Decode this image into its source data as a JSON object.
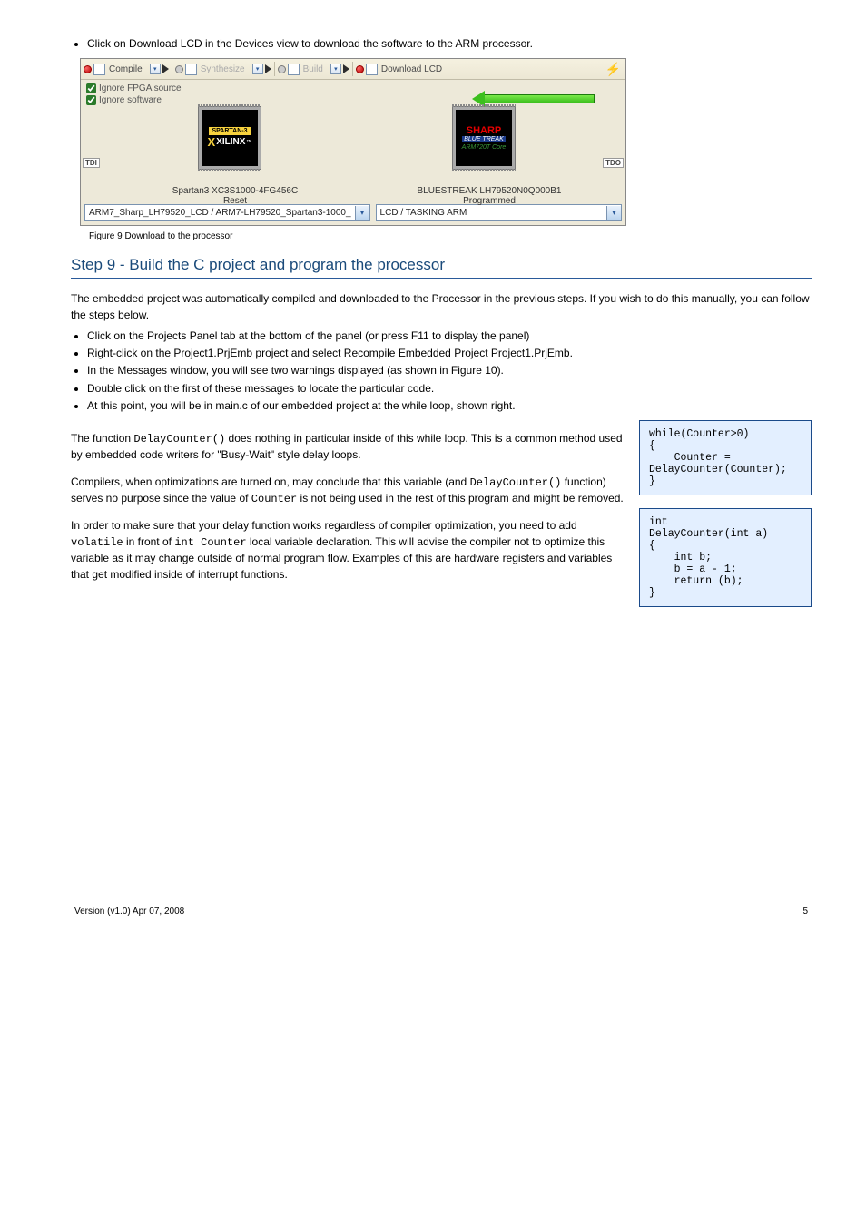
{
  "bullet_top": "Click on Download LCD in the Devices view to download the software to the ARM processor.",
  "screenshot": {
    "toolbar": {
      "compile": "Compile",
      "synthesize": "Synthesize",
      "build": "Build",
      "download": "Download LCD"
    },
    "checks": {
      "fpga": "Ignore FPGA source",
      "sw": "Ignore software"
    },
    "tdi": "TDI",
    "tdo": "TDO",
    "chipA": {
      "spartan": "SPARTAN-3",
      "xilinx": "XILINX",
      "label1": "Spartan3 XC3S1000-4FG456C",
      "label2": "Reset"
    },
    "chipB": {
      "sharp": "SHARP",
      "blue": "BLUE   TREAK",
      "core": "ARM720T Core",
      "label1": "BLUESTREAK LH79520N0Q000B1",
      "label2": "Programmed"
    },
    "combo1": "ARM7_Sharp_LH79520_LCD / ARM7-LH79520_Spartan3-1000_",
    "combo2": "LCD / TASKING ARM"
  },
  "fig_caption": "Figure 9 Download to the processor",
  "section": {
    "title": "Step 9 - Build the C project and program the processor",
    "intro": "The embedded project was automatically compiled and downloaded to the Processor in the previous steps. If you wish to do this manually, you can follow the steps below.",
    "bullets": [
      "Click on the Projects Panel tab at the bottom of the panel (or press F11 to display the panel)",
      "Right-click on the Project1.PrjEmb project and select Recompile Embedded Project Project1.PrjEmb.",
      "In the Messages window, you will see two warnings displayed (as shown in Figure 10).",
      "Double click on the first of these messages to locate the particular code.",
      "At this point, you will be in main.c of our embedded project at the while loop, shown right."
    ],
    "para1_a": "The function ",
    "para1_code": "DelayCounter()",
    "para1_b": " does nothing in particular inside of this while loop. This is a common method used by embedded code writers for \"Busy-Wait\" style delay loops.",
    "para2_a": "Compilers, when optimizations are turned on, may conclude that this variable (and ",
    "para2_code1": "DelayCounter()",
    "para2_b": " function) serves no purpose since the value of ",
    "para2_code2": "Counter",
    "para2_c": " is not being used in the rest of this program and might be removed.",
    "para3_a": "In order to make sure that your delay function works regardless of compiler optimization, you need to add ",
    "para3_code1": "volatile",
    "para3_b": " in front of ",
    "para3_code2": "int Counter",
    "para3_c": " local variable declaration. This will advise the compiler not to optimize this variable as it may change outside of normal program flow. Examples of this are hardware registers and variables that get modified inside of interrupt functions."
  },
  "codebox1": "while(Counter>0)\n{\n    Counter =\nDelayCounter(Counter);\n}",
  "codebox2": "int\nDelayCounter(int a)\n{\n    int b;\n    b = a - 1;\n    return (b);\n}",
  "footer": {
    "left": "Version (v1.0) Apr 07, 2008",
    "right": "5"
  }
}
